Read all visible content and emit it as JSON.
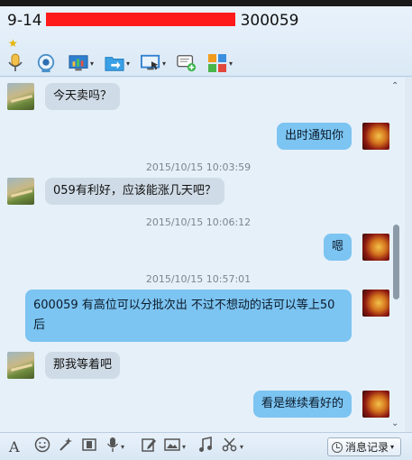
{
  "window": {
    "title_prefix": "9-14",
    "title_suffix": "300059",
    "star": "★"
  },
  "toolbar": {
    "icons": [
      "microphone-icon",
      "video-call-icon",
      "screen-share-icon",
      "file-transfer-icon",
      "remote-assist-icon",
      "add-message-icon",
      "apps-icon"
    ],
    "dropdown_glyph": "▾"
  },
  "messages": [
    {
      "side": "left",
      "text": "今天卖吗？"
    },
    {
      "side": "right",
      "text": "出时通知你"
    },
    {
      "side": "timestamp",
      "text": "2015/10/15 10:03:59"
    },
    {
      "side": "left",
      "text": "059有利好，应该能涨几天吧？"
    },
    {
      "side": "timestamp",
      "text": "2015/10/15 10:06:12"
    },
    {
      "side": "right",
      "text": "嗯"
    },
    {
      "side": "timestamp",
      "text": "2015/10/15 10:57:01"
    },
    {
      "side": "right",
      "text": "600059  有高位可以分批次出  不过不想动的话可以等上50后"
    },
    {
      "side": "left",
      "text": "那我等着吧"
    },
    {
      "side": "right",
      "text": "看是继续看好的"
    }
  ],
  "input_toolbar": {
    "font_glyph": "A",
    "history_label": "消息记录",
    "dropdown_glyph": "▾"
  },
  "scroll": {
    "up_glyph": "⌃",
    "down_glyph": "⌄"
  },
  "colors": {
    "my_bubble": "#7cc4f1",
    "their_bubble": "#cfdbe6",
    "redaction": "#ff1a1a"
  }
}
